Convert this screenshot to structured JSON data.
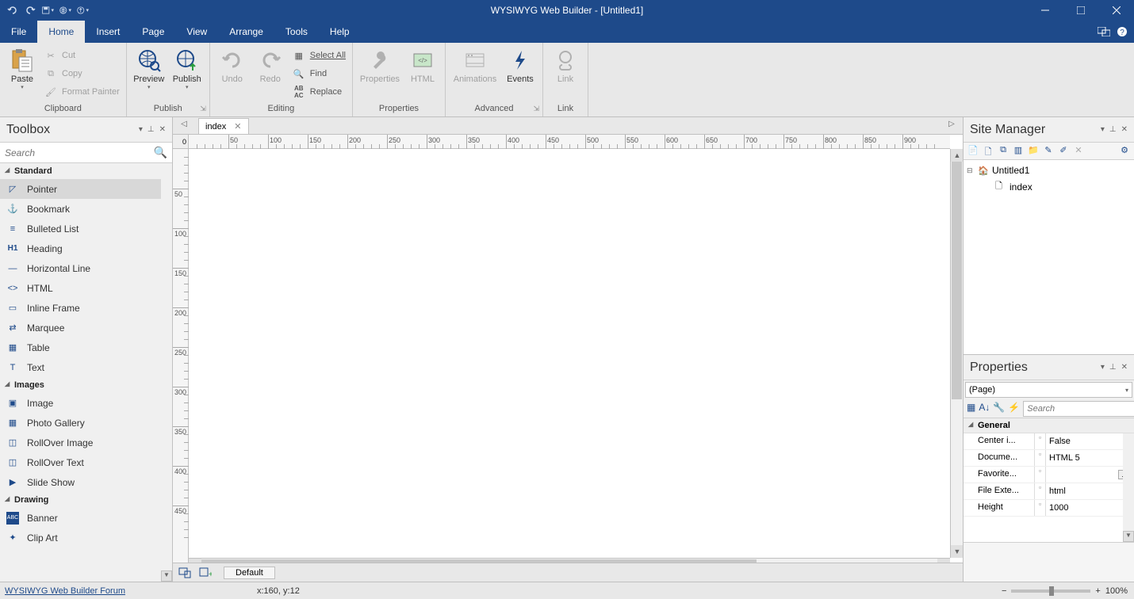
{
  "app": {
    "title": "WYSIWYG Web Builder - [Untitled1]"
  },
  "menu": {
    "items": [
      "File",
      "Home",
      "Insert",
      "Page",
      "View",
      "Arrange",
      "Tools",
      "Help"
    ],
    "active": 1
  },
  "ribbon": {
    "groups": {
      "clipboard": {
        "label": "Clipboard",
        "paste": "Paste",
        "cut": "Cut",
        "copy": "Copy",
        "painter": "Format Painter"
      },
      "publish": {
        "label": "Publish",
        "preview": "Preview",
        "publish": "Publish"
      },
      "editing": {
        "label": "Editing",
        "undo": "Undo",
        "redo": "Redo",
        "selectall": "Select All",
        "find": "Find",
        "replace": "Replace"
      },
      "properties": {
        "label": "Properties",
        "properties": "Properties",
        "html": "HTML"
      },
      "advanced": {
        "label": "Advanced",
        "animations": "Animations",
        "events": "Events"
      },
      "link": {
        "label": "Link",
        "link": "Link"
      }
    }
  },
  "toolbox": {
    "title": "Toolbox",
    "search": "Search",
    "categories": [
      {
        "name": "Standard",
        "items": [
          "Pointer",
          "Bookmark",
          "Bulleted List",
          "Heading",
          "Horizontal Line",
          "HTML",
          "Inline Frame",
          "Marquee",
          "Table",
          "Text"
        ]
      },
      {
        "name": "Images",
        "items": [
          "Image",
          "Photo Gallery",
          "RollOver Image",
          "RollOver Text",
          "Slide Show"
        ]
      },
      {
        "name": "Drawing",
        "items": [
          "Banner",
          "Clip Art"
        ]
      }
    ],
    "selected": "Pointer"
  },
  "document": {
    "tab": "index",
    "breakpoint": "Default"
  },
  "ruler": {
    "h": [
      "0",
      "50",
      "100",
      "150",
      "200",
      "250",
      "300",
      "350",
      "400",
      "450",
      "500",
      "550",
      "600",
      "650",
      "700",
      "750",
      "800",
      "850",
      "900"
    ],
    "v": [
      "0",
      "50",
      "100",
      "150",
      "200",
      "250",
      "300",
      "350",
      "400",
      "450"
    ]
  },
  "sitemanager": {
    "title": "Site Manager",
    "root": "Untitled1",
    "children": [
      "index"
    ]
  },
  "properties": {
    "title": "Properties",
    "selector": "(Page)",
    "search": "Search",
    "groups": [
      {
        "name": "General",
        "rows": [
          {
            "name": "Center i...",
            "value": "False"
          },
          {
            "name": "Docume...",
            "value": "HTML 5"
          },
          {
            "name": "Favorite...",
            "value": "",
            "more": true
          },
          {
            "name": "File Exte...",
            "value": "html"
          },
          {
            "name": "Height",
            "value": "1000"
          }
        ]
      }
    ]
  },
  "statusbar": {
    "forum": "WYSIWYG Web Builder Forum",
    "coords": "x:160, y:12",
    "zoom": "100%"
  }
}
